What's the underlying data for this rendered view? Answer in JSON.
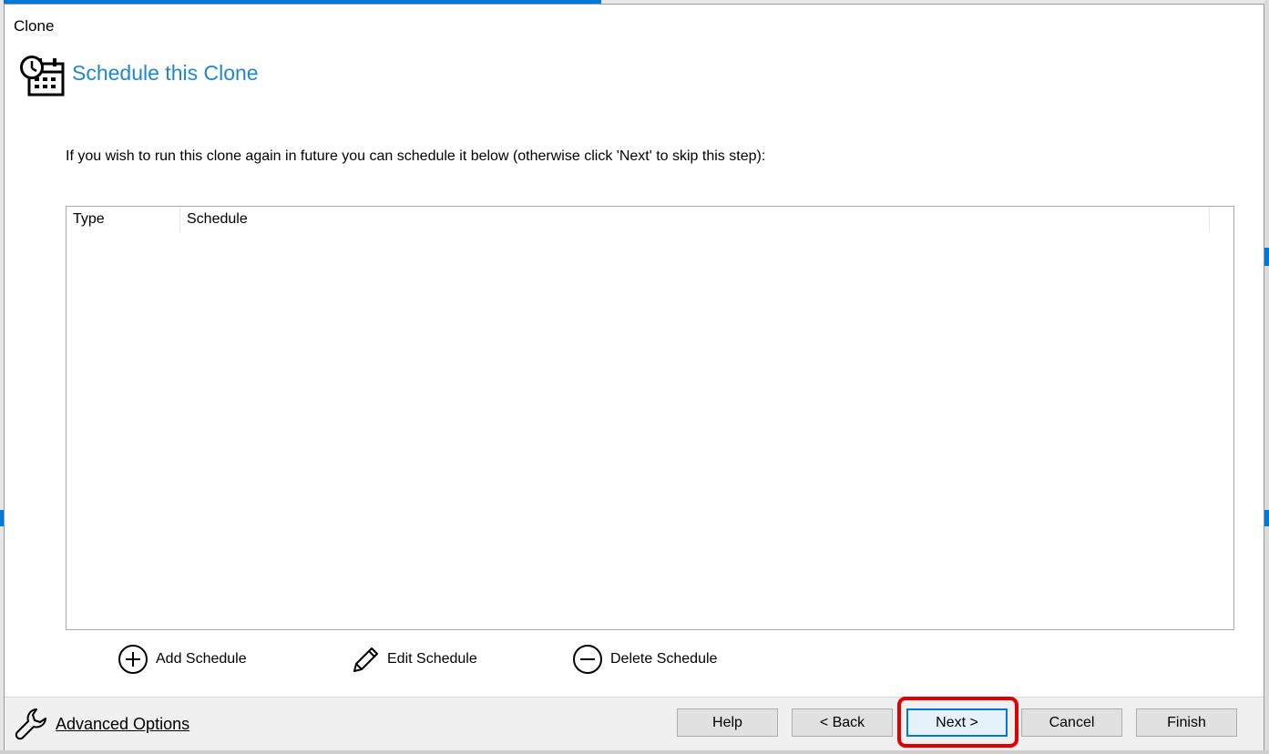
{
  "window": {
    "title": "Clone"
  },
  "header": {
    "title": "Schedule this Clone",
    "icon": "clock-calendar-icon"
  },
  "instruction": "If you wish to run this clone again in future you can schedule it below (otherwise click 'Next' to skip this step):",
  "schedule_list": {
    "columns": [
      "Type",
      "Schedule"
    ],
    "rows": []
  },
  "actions": {
    "add": {
      "label": "Add Schedule",
      "icon": "plus-circle-icon"
    },
    "edit": {
      "label": "Edit Schedule",
      "icon": "pencil-icon"
    },
    "delete": {
      "label": "Delete Schedule",
      "icon": "minus-circle-icon"
    }
  },
  "footer": {
    "advanced_options": {
      "label": "Advanced Options",
      "icon": "wrench-icon"
    },
    "buttons": {
      "help": "Help",
      "back": "< Back",
      "next": "Next >",
      "cancel": "Cancel",
      "finish": "Finish"
    }
  },
  "colors": {
    "accent": "#1e87d0",
    "highlight": "#e00000",
    "focus_border": "#0078d7"
  }
}
